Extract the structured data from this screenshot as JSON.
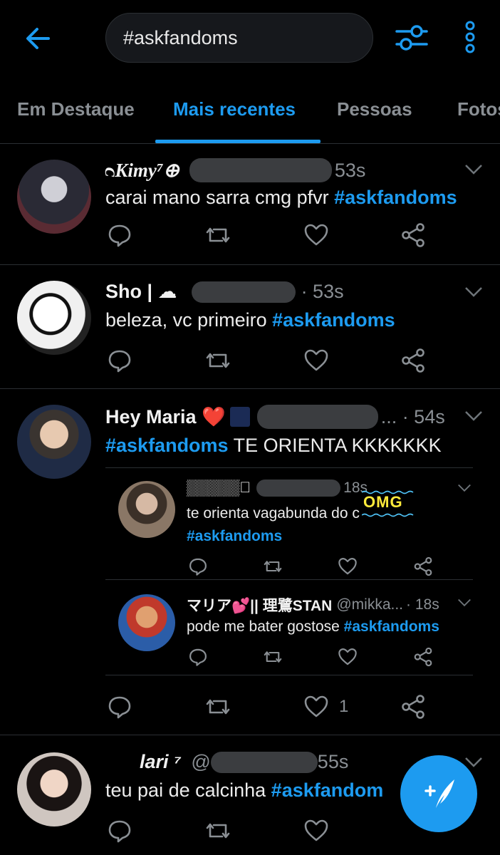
{
  "search": {
    "query": "#askfandoms"
  },
  "tabs": [
    {
      "label": "Em Destaque"
    },
    {
      "label": "Mais recentes"
    },
    {
      "label": "Pessoas"
    },
    {
      "label": "Fotos"
    }
  ],
  "tweets": [
    {
      "name": "ᴒKimy⁷⊕",
      "time": "53s",
      "text": "carai mano sarra cmg pfvr ",
      "tag": "#askfandoms"
    },
    {
      "name": "Sho | ☁",
      "time": "· 53s",
      "text": "beleza, vc primeiro ",
      "tag": "#askfandoms"
    },
    {
      "name": "Hey Maria ❤️",
      "time": "... · 54s",
      "tag": "#askfandoms",
      "text": " TE ORIENTA KKKKKKK",
      "like_count": "1",
      "replies": [
        {
          "name": "▒▒▒▒▒ᷟ",
          "time": "18s",
          "text": "te orienta vagabunda do c",
          "tag": "#askfandoms"
        },
        {
          "name": "マリア💕|| 理鷺STAN",
          "handle": "@mikka...",
          "time": "· 18s",
          "text": "pode me bater gostose ",
          "tag": "#askfandoms"
        }
      ]
    },
    {
      "name": "❥ᷟ lari ⁷",
      "handle": "@",
      "time": "55s",
      "text": "teu pai de calcinha ",
      "tag": "#askfandom"
    }
  ],
  "overlay": {
    "omg": "OMG"
  },
  "icons": [
    "back-arrow-icon",
    "filter-sliders-icon",
    "more-vertical-icon",
    "reply-icon",
    "retweet-icon",
    "like-icon",
    "share-icon",
    "chevron-down-icon",
    "compose-icon"
  ],
  "colors": {
    "accent": "#1d9bf0",
    "background": "#000000",
    "muted": "#8a8f94"
  }
}
